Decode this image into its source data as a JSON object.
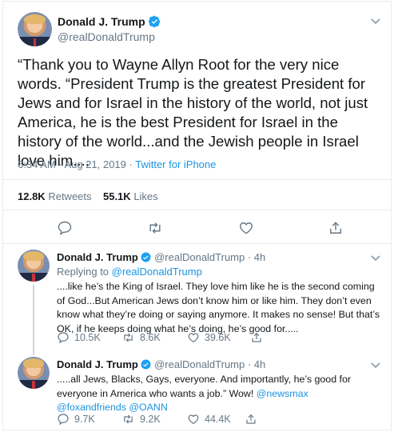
{
  "main_tweet": {
    "name": "Donald J. Trump",
    "handle": "@realDonaldTrump",
    "text": "“Thank you to Wayne Allyn Root for the very nice words. “President Trump is the greatest President for Jews and for Israel in the history of the world, not just America, he is the best President for Israel in the history of the world...and the Jewish people in Israel love him....",
    "time": "6:34 AM · Aug 21, 2019 ·",
    "source": "Twitter for iPhone",
    "retweets_count": "12.8K",
    "retweets_label": "Retweets",
    "likes_count": "55.1K",
    "likes_label": "Likes"
  },
  "reply1": {
    "name": "Donald J. Trump",
    "handle_time": "@realDonaldTrump · 4h",
    "replying_prefix": "Replying to",
    "replying_handle": "@realDonaldTrump",
    "text": "....like he’s the King of Israel. They love him like he is the second coming of God...But American Jews don’t know him or like him. They don’t even know what they’re doing or saying anymore. It makes no sense! But that’s OK, if he keeps doing what he’s doing, he’s good for.....",
    "replies": "10.5K",
    "retweets": "8.6K",
    "likes": "39.6K"
  },
  "reply2": {
    "name": "Donald J. Trump",
    "handle_time": "@realDonaldTrump · 4h",
    "text": ".....all Jews, Blacks, Gays, everyone. And importantly, he’s good for everyone in America who wants a job.” Wow!",
    "mention1": "@newsmax",
    "mention2": "@foxandfriends",
    "mention3": "@OANN",
    "replies": "9.7K",
    "retweets": "9.2K",
    "likes": "44.4K"
  },
  "icons": [
    "verified-badge-icon",
    "chevron-down-icon",
    "reply-icon",
    "retweet-icon",
    "like-icon",
    "share-icon"
  ],
  "colors": {
    "accent": "#1b95e0",
    "muted": "#657786",
    "text": "#14171a",
    "border": "#e6ecf0"
  }
}
